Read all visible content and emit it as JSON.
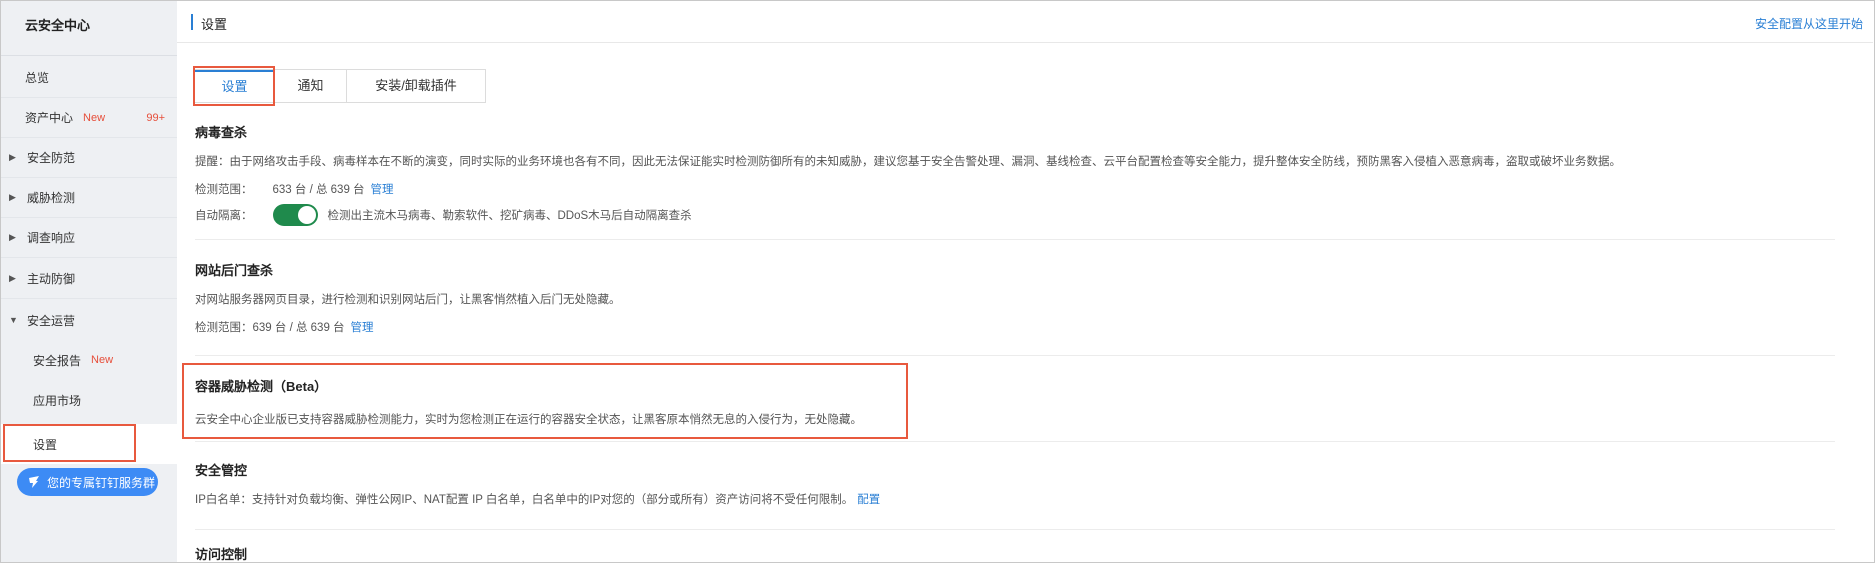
{
  "sidebar": {
    "title": "云安全中心",
    "items": [
      {
        "label": "总览"
      },
      {
        "label": "资产中心",
        "badge": "New",
        "count": "99+"
      },
      {
        "label": "安全防范"
      },
      {
        "label": "威胁检测"
      },
      {
        "label": "调查响应"
      },
      {
        "label": "主动防御"
      },
      {
        "label": "安全运营"
      },
      {
        "label": "安全报告",
        "badge": "New"
      },
      {
        "label": "应用市场"
      },
      {
        "label": "设置"
      }
    ],
    "dingtalk_label": "您的专属钉钉服务群"
  },
  "header": {
    "title": "设置",
    "link": "安全配置从这里开始"
  },
  "tabs": [
    {
      "label": "设置"
    },
    {
      "label": "通知"
    },
    {
      "label": "安装/卸载插件"
    }
  ],
  "sections": {
    "virus": {
      "title": "病毒查杀",
      "desc": "提醒：由于网络攻击手段、病毒样本在不断的演变，同时实际的业务环境也各有不同，因此无法保证能实时检测防御所有的未知威胁，建议您基于安全告警处理、漏洞、基线检查、云平台配置检查等安全能力，提升整体安全防线，预防黑客入侵植入恶意病毒，盗取或破坏业务数据。",
      "scope_label": "检测范围：",
      "scope_value": "633 台 / 总 639 台",
      "manage": "管理",
      "isolate_label": "自动隔离：",
      "isolate_desc": "检测出主流木马病毒、勒索软件、挖矿病毒、DDoS木马后自动隔离查杀",
      "isolate_on": true
    },
    "webshell": {
      "title": "网站后门查杀",
      "desc": "对网站服务器网页目录，进行检测和识别网站后门，让黑客悄然植入后门无处隐藏。",
      "scope_label": "检测范围：",
      "scope_value": "639 台 / 总 639 台",
      "manage": "管理"
    },
    "container": {
      "title": "容器威胁检测（Beta）",
      "desc": "云安全中心企业版已支持容器威胁检测能力，实时为您检测正在运行的容器安全状态，让黑客原本悄然无息的入侵行为，无处隐藏。"
    },
    "control": {
      "title": "安全管控",
      "desc": "IP白名单：支持针对负载均衡、弹性公网IP、NAT配置 IP 白名单，白名单中的IP对您的（部分或所有）资产访问将不受任何限制。",
      "config": "配置"
    },
    "access": {
      "title": "访问控制"
    }
  }
}
